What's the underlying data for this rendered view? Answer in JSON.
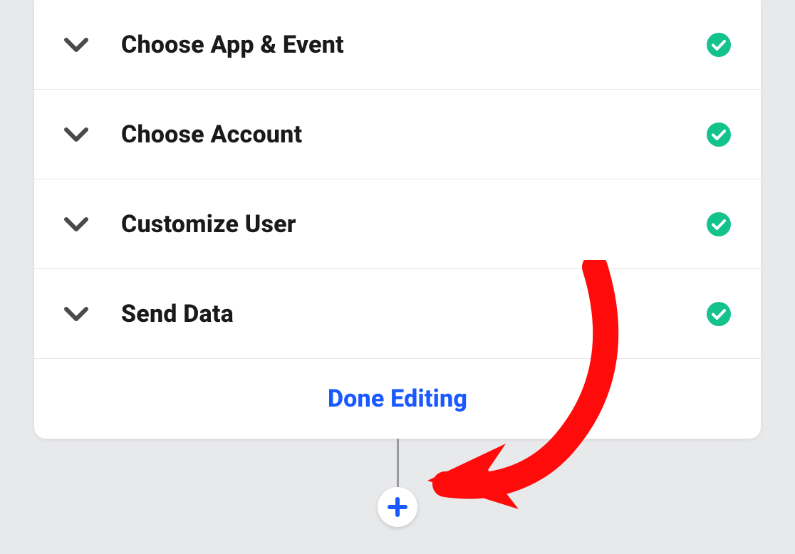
{
  "steps": [
    {
      "label": "Choose App & Event",
      "completed": true
    },
    {
      "label": "Choose Account",
      "completed": true
    },
    {
      "label": "Customize User",
      "completed": true
    },
    {
      "label": "Send Data",
      "completed": true
    }
  ],
  "doneLabel": "Done Editing",
  "colors": {
    "link": "#1959ff",
    "check": "#14c28c",
    "plus": "#1959ff",
    "annotation": "#ff0b0b"
  }
}
